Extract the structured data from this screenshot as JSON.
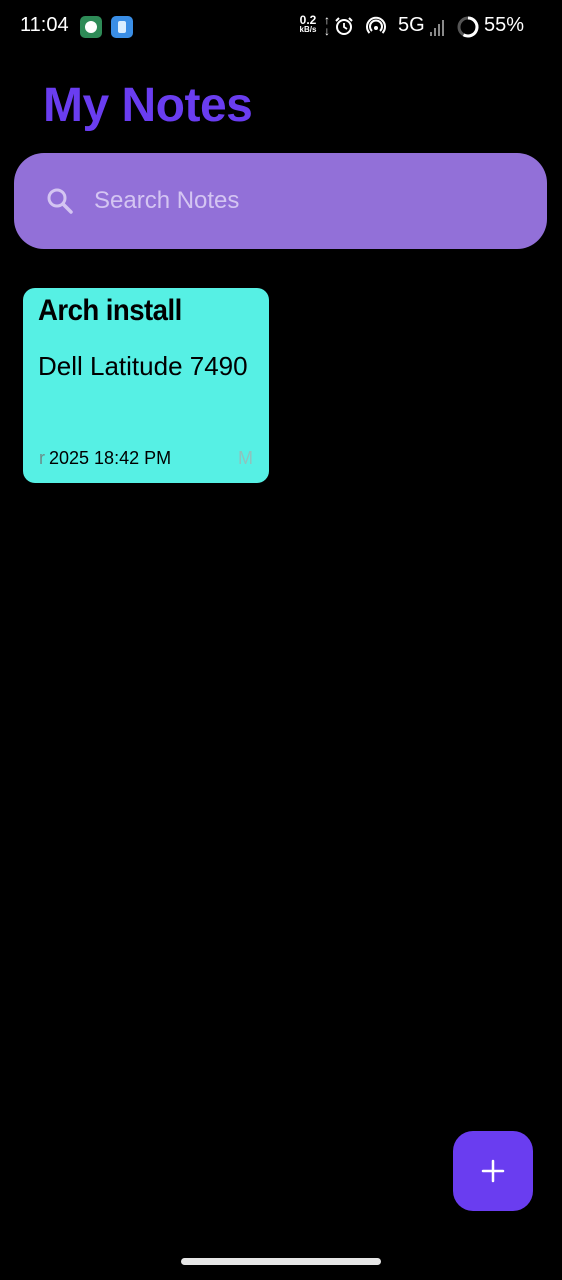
{
  "status_bar": {
    "time": "11:04",
    "net_speed_value": "0.2",
    "net_speed_unit": "kB/s",
    "network_type": "5G",
    "battery_percent": "55%",
    "icons": [
      "app-icon-green",
      "app-icon-blue",
      "data-arrows-icon",
      "alarm-icon",
      "hotspot-icon",
      "signal-icon",
      "battery-ring-icon"
    ]
  },
  "header": {
    "title": "My Notes"
  },
  "search": {
    "placeholder": "Search Notes",
    "value": "",
    "icon": "search-icon"
  },
  "notes": [
    {
      "title": "Arch install",
      "body": "Dell Latitude 7490",
      "date_visible": "2025 18:42 PM",
      "left_clipped_glyph": "r",
      "right_clipped_glyph": "M",
      "background_color": "#56f0e4"
    }
  ],
  "fab": {
    "icon": "plus-icon"
  },
  "colors": {
    "background": "#000000",
    "accent": "#6a3df0",
    "search_background": "#9270d8",
    "search_placeholder": "#d4c5f2",
    "note_card": "#56f0e4"
  }
}
